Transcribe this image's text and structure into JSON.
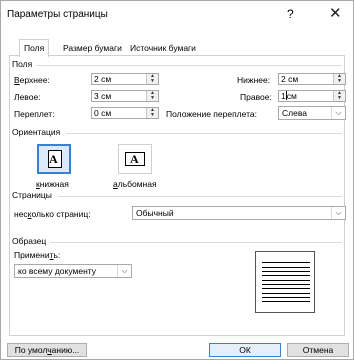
{
  "window": {
    "title": "Параметры страницы",
    "help_glyph": "?",
    "close_glyph": "✕"
  },
  "tabs": [
    {
      "label": "Поля",
      "active": true
    },
    {
      "label": "Размер бумаги",
      "active": false
    },
    {
      "label": "Источник бумаги",
      "active": false
    }
  ],
  "margins": {
    "group_label": "Поля",
    "top_label": "Верхнее:",
    "top_value": "2 см",
    "bottom_label": "Нижнее:",
    "bottom_value": "2 см",
    "left_label": "Левое:",
    "left_value": "3 см",
    "right_label": "Правое:",
    "right_value_before": "1",
    "right_value_after": "см",
    "gutter_label": "Переплет:",
    "gutter_value": "0 см",
    "gutter_pos_label": "Положение переплета:",
    "gutter_pos_value": "Слева"
  },
  "orientation": {
    "group_label": "Ориентация",
    "portrait_label": "книжная",
    "landscape_label": "альбомная",
    "portrait_glyph": "A",
    "landscape_glyph": "A"
  },
  "pages": {
    "group_label": "Страницы",
    "multiple_label": "несколько страниц:",
    "multiple_value": "Обычный"
  },
  "sample": {
    "group_label": "Образец",
    "apply_label": "Применить:",
    "apply_value": "ко всему документу"
  },
  "buttons": {
    "default_label": "По умолчанию...",
    "ok_label": "ОК",
    "cancel_label": "Отмена"
  },
  "icons": {
    "spin_up": "▲",
    "spin_down": "▼",
    "dropdown": "⌵"
  },
  "colors": {
    "accent": "#3c7fcc",
    "selected_fill": "#dbe9f8"
  }
}
